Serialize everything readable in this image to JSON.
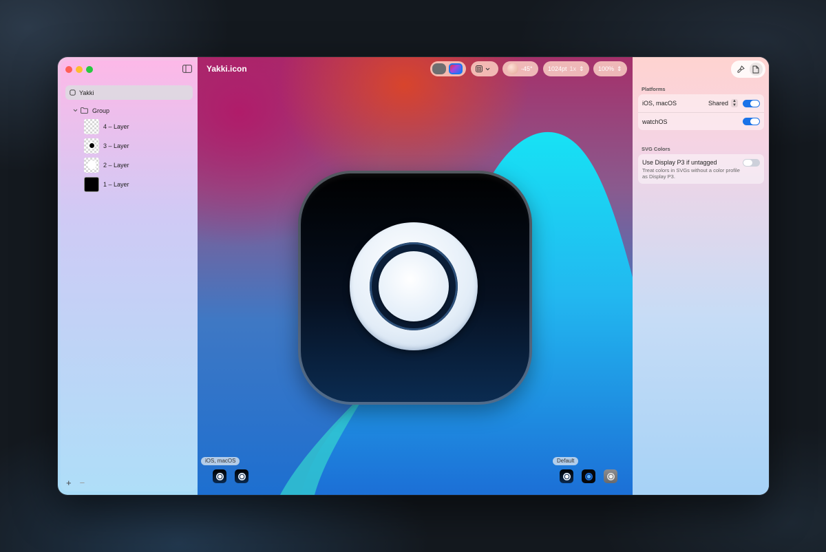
{
  "window": {
    "title": "Yakki.icon"
  },
  "sidebar": {
    "root_label": "Yakki",
    "group_label": "Group",
    "layers": [
      {
        "label": "4 – Layer",
        "thumb": "checker-blank"
      },
      {
        "label": "3 – Layer",
        "thumb": "checker-dot"
      },
      {
        "label": "2 – Layer",
        "thumb": "checker-white"
      },
      {
        "label": "1 – Layer",
        "thumb": "black"
      }
    ],
    "add_label": "+",
    "remove_label": "−"
  },
  "toolbar": {
    "light_angle": "-45°",
    "size": "1024pt",
    "scale": "1x",
    "zoom": "100%"
  },
  "canvas": {
    "platform_tag": "iOS, macOS",
    "appearance_tag": "Default"
  },
  "inspector": {
    "platforms_title": "Platforms",
    "ios_macos_label": "iOS, macOS",
    "ios_macos_mode": "Shared",
    "ios_macos_enabled": true,
    "watchos_label": "watchOS",
    "watchos_enabled": true,
    "svg_colors_title": "SVG Colors",
    "display_p3_label": "Use Display P3 if untagged",
    "display_p3_description": "Treat colors in SVGs without a color profile as Display P3.",
    "display_p3_enabled": false
  },
  "colors": {
    "accent": "#1a73e8",
    "icon_background_top": "#000000",
    "icon_background_bottom": "#0b2c52"
  }
}
